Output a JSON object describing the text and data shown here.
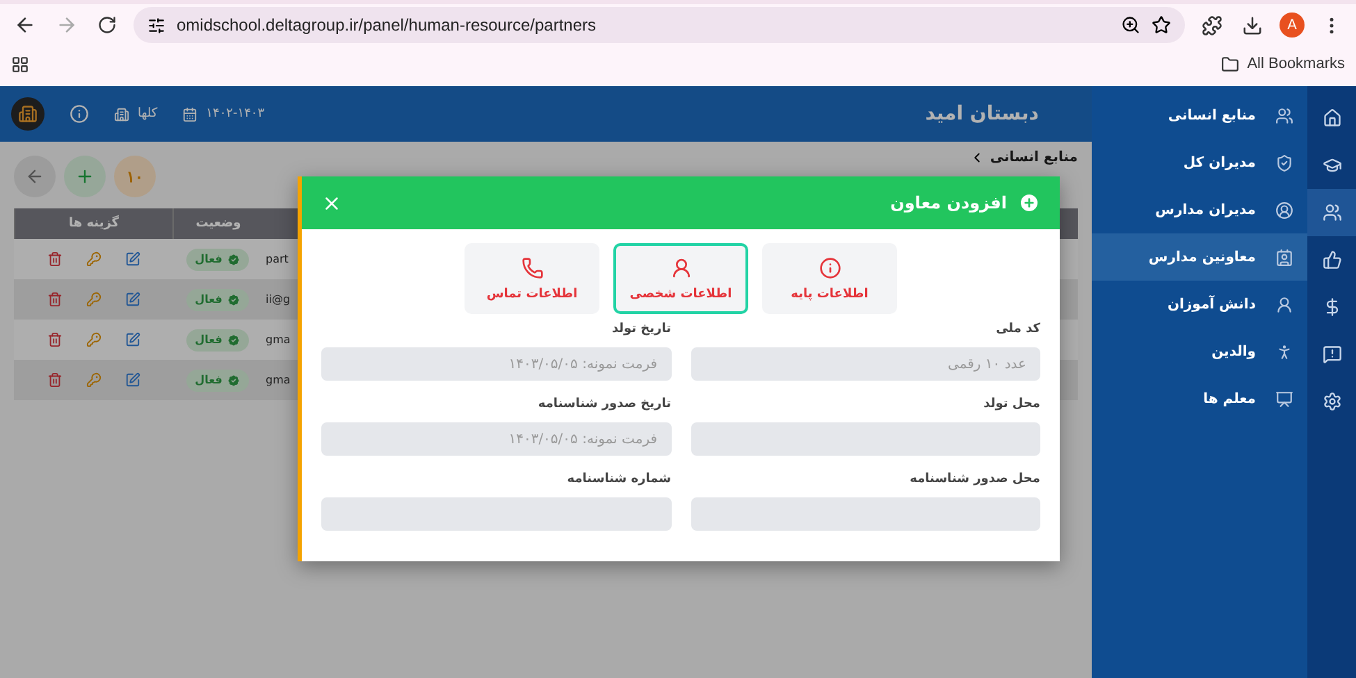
{
  "browser": {
    "url": "omidschool.deltagroup.ir/panel/human-resource/partners",
    "avatar": "A",
    "bookmarks": "All Bookmarks"
  },
  "header": {
    "title": "دبستان امید",
    "school_year": "۱۴۰۲-۱۴۰۳",
    "scope": "کلها"
  },
  "breadcrumb": [
    "منابع انسانی"
  ],
  "toolbar": {
    "count": "۱۰"
  },
  "table": {
    "columns": [
      "وضعیت",
      "گزینه ها"
    ],
    "rows": [
      {
        "status": "فعال",
        "column_3": "part"
      },
      {
        "status": "فعال",
        "column_3": "ii@g"
      },
      {
        "status": "فعال",
        "column_3": "gma"
      },
      {
        "status": "فعال",
        "column_3": "gma"
      }
    ]
  },
  "rail": [
    {
      "selected": false
    },
    {
      "selected": false
    },
    {
      "selected": true
    },
    {
      "selected": false
    },
    {
      "selected": false
    },
    {
      "selected": false
    },
    {
      "selected": false
    }
  ],
  "sidebar": {
    "items": [
      {
        "label": "منابع انسانی",
        "selected": false
      },
      {
        "label": "مدیران کل",
        "selected": false
      },
      {
        "label": "مدیران مدارس",
        "selected": false
      },
      {
        "label": "معاونین مدارس",
        "selected": true
      },
      {
        "label": "دانش آموزان",
        "selected": false
      },
      {
        "label": "والدین",
        "selected": false
      },
      {
        "label": "معلم ها",
        "selected": false
      }
    ]
  },
  "modal": {
    "title": "افزودن معاون",
    "tabs": [
      {
        "label": "اطلاعات پایه",
        "selected": false
      },
      {
        "label": "اطلاعات شخصی",
        "selected": true
      },
      {
        "label": "اطلاعات تماس",
        "selected": false
      }
    ],
    "fields": [
      {
        "label": "کد ملی",
        "placeholder": "عدد ۱۰ رقمی"
      },
      {
        "label": "تاریخ تولد",
        "placeholder": "فرمت نمونه: ۱۴۰۳/۰۵/۰۵"
      },
      {
        "label": "محل تولد"
      },
      {
        "label": "تاریخ صدور شناسنامه",
        "placeholder": "فرمت نمونه: ۱۴۰۳/۰۵/۰۵"
      },
      {
        "label": "محل صدور شناسنامه"
      },
      {
        "label": "شماره شناسنامه"
      }
    ]
  }
}
